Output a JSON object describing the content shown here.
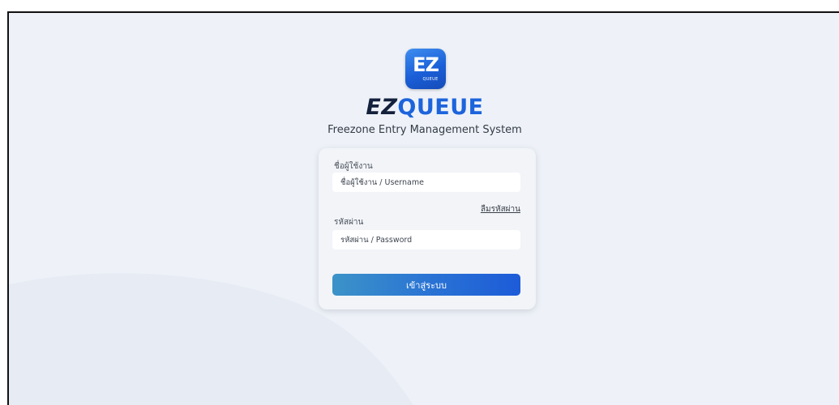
{
  "logo": {
    "tile_big": "EZ",
    "tile_small": "QUEUE",
    "brand_part1": "EZ",
    "brand_part2": "QUEUE",
    "subtitle": "Freezone Entry Management System"
  },
  "form": {
    "username_label": "ชื่อผู้ใช้งาน",
    "username_placeholder": "ชื่อผู้ใช้งาน / Username",
    "username_value": "",
    "forgot_password_link": "ลืมรหัสผ่าน",
    "password_label": "รหัสผ่าน",
    "password_placeholder": "รหัสผ่าน / Password",
    "password_value": "",
    "submit_label": "เข้าสู่ระบบ"
  },
  "colors": {
    "brand_dark": "#14213d",
    "brand_blue": "#1d64dc",
    "page_background": "#eef2f8",
    "button_gradient_start": "#3c93c8",
    "button_gradient_end": "#1d5bd8"
  }
}
